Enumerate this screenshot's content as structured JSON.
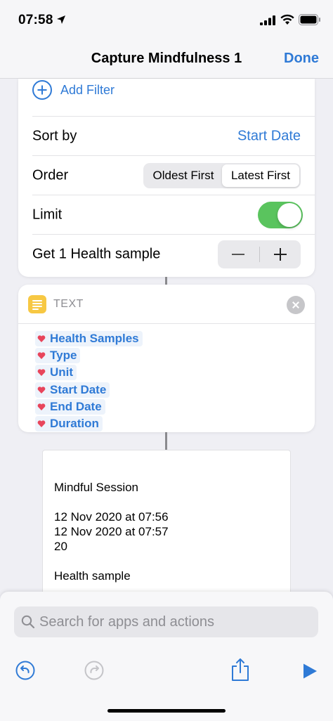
{
  "status_bar": {
    "time": "07:58",
    "icons": [
      "location-arrow-icon",
      "signal-icon",
      "wifi-icon",
      "battery-icon"
    ]
  },
  "nav": {
    "title": "Capture Mindfulness 1",
    "done_label": "Done"
  },
  "find_action": {
    "add_filter_label": "Add Filter",
    "sort_by_label": "Sort by",
    "sort_by_value": "Start Date",
    "order_label": "Order",
    "order_options": [
      "Oldest First",
      "Latest First"
    ],
    "order_selected": "Latest First",
    "limit_label": "Limit",
    "limit_on": true,
    "get_label": "Get 1 Health sample",
    "stepper_minus": "—",
    "stepper_plus": "+"
  },
  "text_action": {
    "title": "TEXT",
    "icon": "text-document-icon",
    "tokens": [
      "Health Samples",
      "Type",
      "Unit",
      "Start Date",
      "End Date",
      "Duration"
    ],
    "token_icon": "health-heart-icon"
  },
  "result": {
    "text": "Mindful Session\n\n12 Nov 2020 at 07:56\n12 Nov 2020 at 07:57\n20\n\nHealth sample"
  },
  "bottom": {
    "search_placeholder": "Search for apps and actions",
    "toolbar_icons": [
      "undo-icon",
      "redo-icon",
      "share-icon",
      "play-icon"
    ]
  },
  "colors": {
    "accent": "#2f7ad6",
    "toggle_on": "#5ac45e",
    "text_icon_bg": "#f7c843",
    "heart": "#e8455b"
  }
}
